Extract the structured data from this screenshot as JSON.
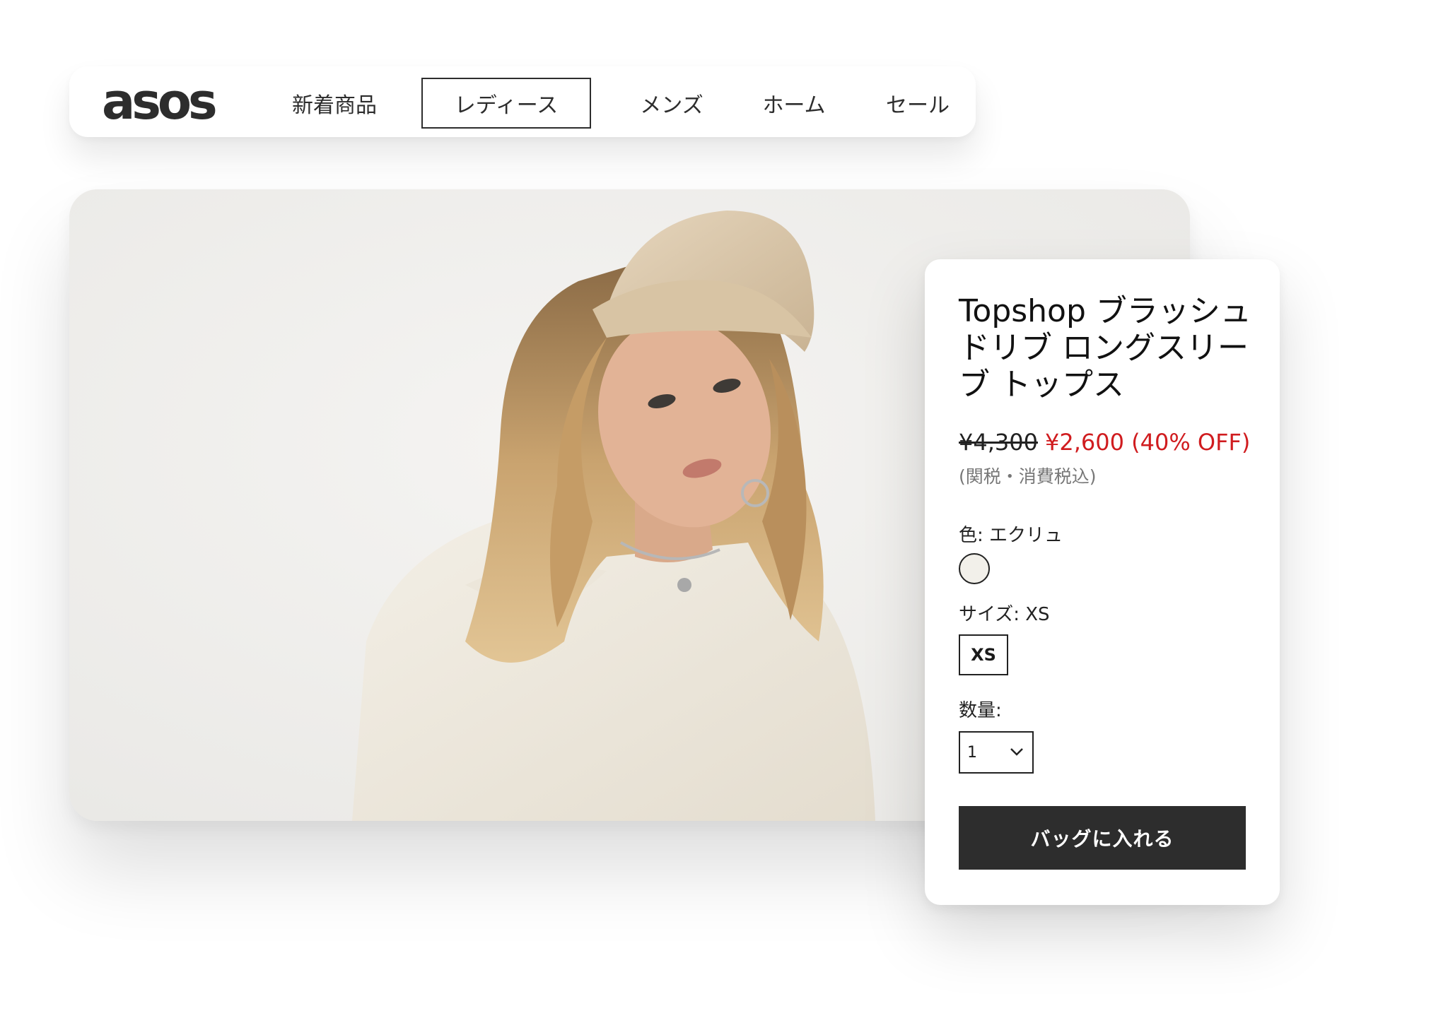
{
  "brand": {
    "logo_text": "asos"
  },
  "nav": {
    "items": [
      {
        "label": "新着商品",
        "active": false
      },
      {
        "label": "レディース",
        "active": true
      },
      {
        "label": "メンズ",
        "active": false
      },
      {
        "label": "ホーム",
        "active": false
      },
      {
        "label": "セール",
        "active": false
      }
    ]
  },
  "product": {
    "title": "Topshop ブラッシュドリブ ロングスリーブ トップス",
    "original_price": "¥4,300",
    "sale_price": "¥2,600 (40% OFF)",
    "tax_note": "(関税・消費税込)",
    "color_label": "色: エクリュ",
    "size_label": "サイズ: XS",
    "size_option": "XS",
    "quantity_label": "数量:",
    "quantity_value": "1",
    "add_to_bag_label": "バッグに入れる"
  },
  "colors": {
    "sale_red": "#d01c1f",
    "button_dark": "#2d2d2d",
    "swatch_ecru": "#f2f0ea"
  },
  "icons": {
    "quantity_dropdown": "chevron-down-icon"
  }
}
